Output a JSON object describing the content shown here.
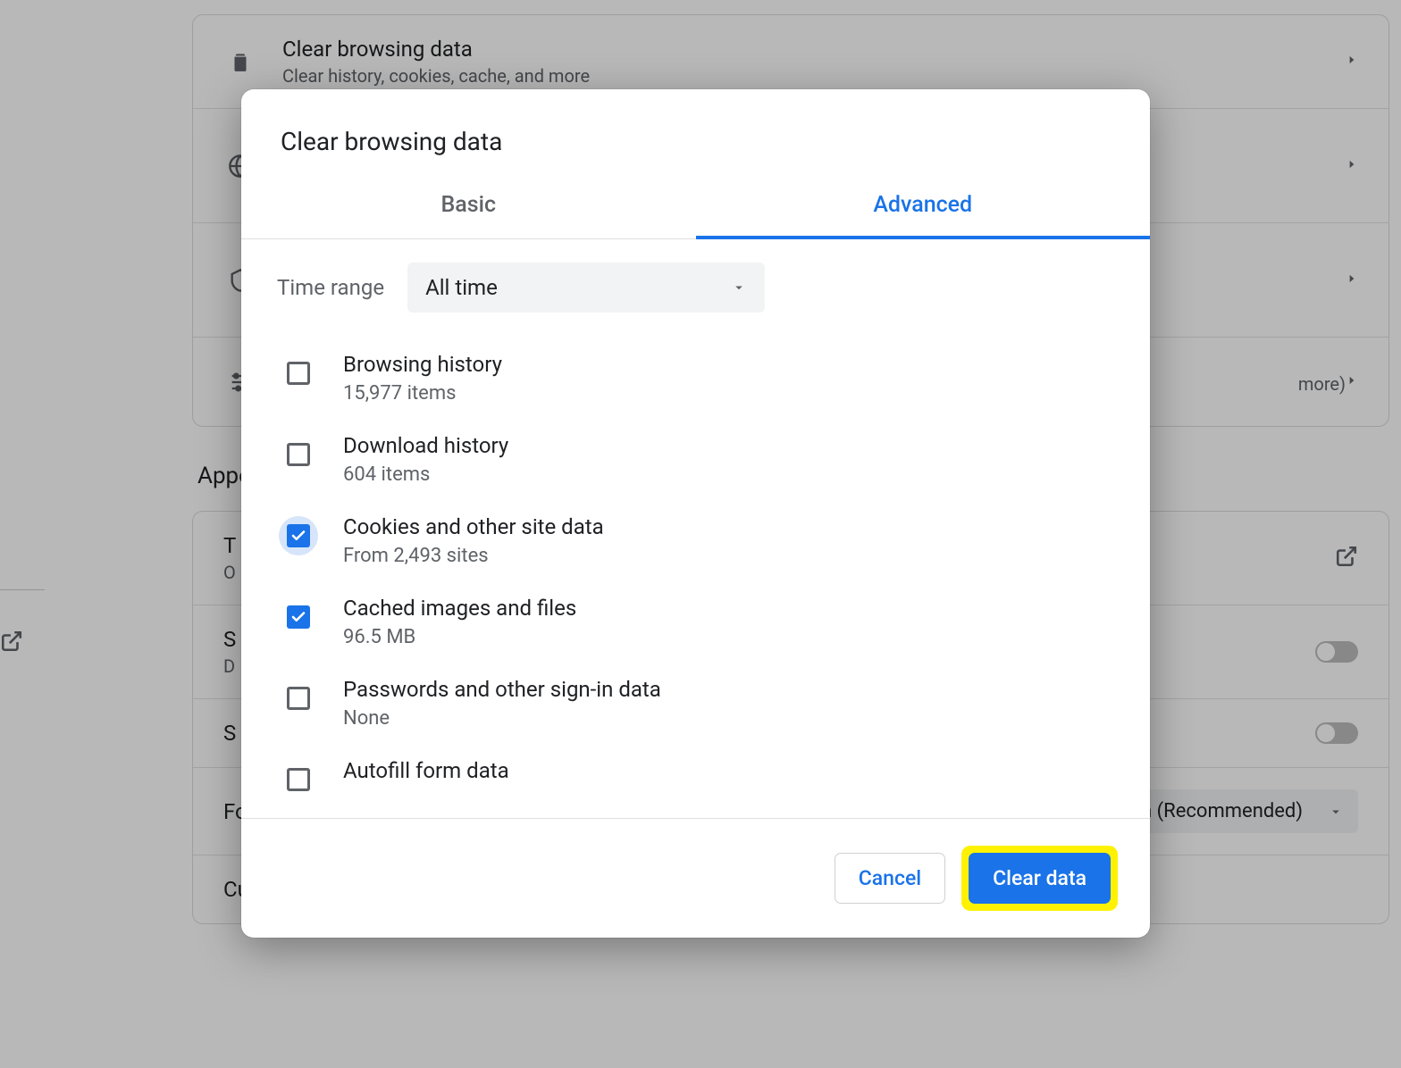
{
  "background": {
    "settings_rows": [
      {
        "title": "Clear browsing data",
        "subtitle": "Clear history, cookies, cache, and more",
        "icon": "trash-icon"
      },
      {
        "title": "",
        "subtitle": "",
        "icon": "globe-icon"
      },
      {
        "title": "",
        "subtitle": "",
        "icon": "shield-icon"
      },
      {
        "title": "",
        "subtitle": "more)",
        "icon": "sliders-icon"
      }
    ],
    "appearance_heading": "Appearance",
    "appearance_rows": {
      "row0_t_stub": "T",
      "row0_o_stub": "O",
      "row1_s_stub": "S",
      "row1_d_stub": "D",
      "row2_s_stub": "S",
      "font_size_label": "Font size",
      "font_size_value": "Medium (Recommended)",
      "customize_fonts": "Customize fonts"
    }
  },
  "dialog": {
    "title": "Clear browsing data",
    "tabs": {
      "basic": "Basic",
      "advanced": "Advanced",
      "active": "advanced"
    },
    "time_range_label": "Time range",
    "time_range_value": "All time",
    "options": [
      {
        "title": "Browsing history",
        "detail": "15,977 items",
        "checked": false,
        "focus": false
      },
      {
        "title": "Download history",
        "detail": "604 items",
        "checked": false,
        "focus": false
      },
      {
        "title": "Cookies and other site data",
        "detail": "From 2,493 sites",
        "checked": true,
        "focus": true
      },
      {
        "title": "Cached images and files",
        "detail": "96.5 MB",
        "checked": true,
        "focus": false
      },
      {
        "title": "Passwords and other sign-in data",
        "detail": "None",
        "checked": false,
        "focus": false
      },
      {
        "title": "Autofill form data",
        "detail": "",
        "checked": false,
        "focus": false
      }
    ],
    "cancel": "Cancel",
    "clear": "Clear data"
  }
}
